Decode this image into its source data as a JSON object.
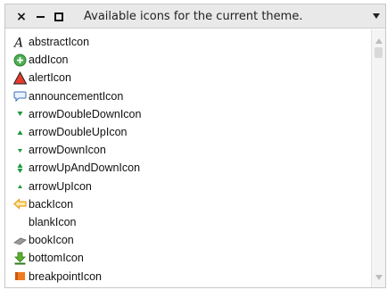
{
  "window": {
    "title": "Available icons for the current theme.",
    "close_glyph": "×"
  },
  "list": {
    "items": [
      {
        "label": "abstractIcon",
        "icon": "abstract-icon"
      },
      {
        "label": "addIcon",
        "icon": "add-icon"
      },
      {
        "label": "alertIcon",
        "icon": "alert-icon"
      },
      {
        "label": "announcementIcon",
        "icon": "announcement-icon"
      },
      {
        "label": "arrowDoubleDownIcon",
        "icon": "arrow-double-down-icon"
      },
      {
        "label": "arrowDoubleUpIcon",
        "icon": "arrow-double-up-icon"
      },
      {
        "label": "arrowDownIcon",
        "icon": "arrow-down-icon"
      },
      {
        "label": "arrowUpAndDownIcon",
        "icon": "arrow-up-and-down-icon"
      },
      {
        "label": "arrowUpIcon",
        "icon": "arrow-up-icon"
      },
      {
        "label": "backIcon",
        "icon": "back-icon"
      },
      {
        "label": "blankIcon",
        "icon": "blank-icon"
      },
      {
        "label": "bookIcon",
        "icon": "book-icon"
      },
      {
        "label": "bottomIcon",
        "icon": "bottom-icon"
      },
      {
        "label": "breakpointIcon",
        "icon": "breakpoint-icon"
      }
    ]
  },
  "colors": {
    "titlebar_bg": "#e9e9e9",
    "add_green": "#4caf50",
    "alert_red": "#e53b2c",
    "arrow_green": "#1a9a3a",
    "back_orange": "#e8a020",
    "bottom_green": "#5cb030",
    "breakpoint_orange": "#f07a1e"
  }
}
